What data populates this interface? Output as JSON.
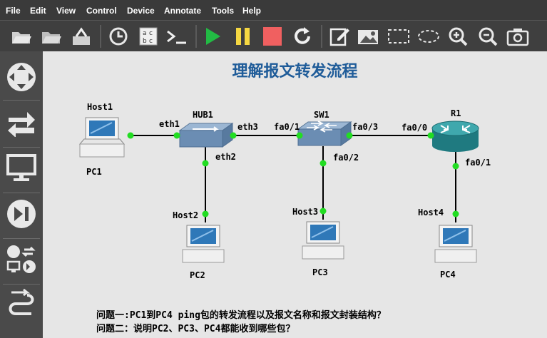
{
  "menu": {
    "file": "File",
    "edit": "Edit",
    "view": "View",
    "control": "Control",
    "device": "Device",
    "annotate": "Annotate",
    "tools": "Tools",
    "help": "Help"
  },
  "toolbar": {
    "icons": [
      "open-folder-icon",
      "open-project-icon",
      "save-snapshot-icon",
      "clock-icon",
      "console-text-icon",
      "terminal-icon",
      "start-icon",
      "pause-icon",
      "stop-icon",
      "reload-icon",
      "edit-note-icon",
      "insert-image-icon",
      "rectangle-icon",
      "ellipse-icon",
      "zoom-in-icon",
      "zoom-out-icon",
      "screenshot-icon"
    ]
  },
  "colors": {
    "title": "#1f5c99",
    "link": "#000000",
    "port_dot": "#22dd22",
    "start": "#22bb44",
    "pause": "#f5d742",
    "stop": "#f06060"
  },
  "diagram": {
    "title": "理解报文转发流程",
    "nodes": {
      "host1": "Host1",
      "pc1": "PC1",
      "hub1": "HUB1",
      "sw1": "SW1",
      "r1": "R1",
      "host2": "Host2",
      "pc2": "PC2",
      "host3": "Host3",
      "pc3": "PC3",
      "host4": "Host4",
      "pc4": "PC4"
    },
    "ports": {
      "hub_eth1": "eth1",
      "hub_eth3": "eth3",
      "hub_eth2": "eth2",
      "sw_fa01": "fa0/1",
      "sw_fa03": "fa0/3",
      "sw_fa02": "fa0/2",
      "r_fa00": "fa0/0",
      "r_fa01": "fa0/1"
    },
    "questions": {
      "q1": "问题一:PC1到PC4 ping包的转发流程以及报文名称和报文封装结构？",
      "q2": "问题二：说明PC2、PC3、PC4都能收到哪些包？"
    }
  }
}
